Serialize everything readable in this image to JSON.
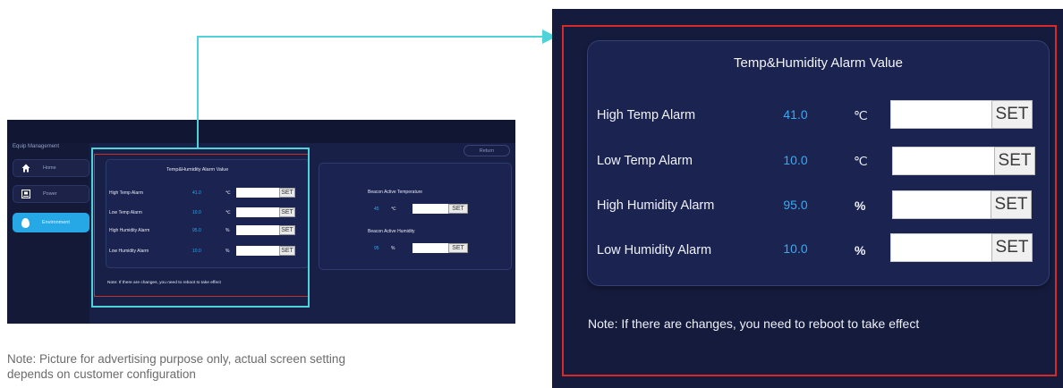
{
  "mini": {
    "sidebar_title": "Equip Management",
    "nav": [
      {
        "label": "Home",
        "icon": "home-icon"
      },
      {
        "label": "Power",
        "icon": "power-panel-icon"
      },
      {
        "label": "Environment",
        "icon": "water-drop-icon"
      }
    ],
    "return_label": "Return",
    "panel_title": "Temp&Humidity Alarm Value",
    "rows": [
      {
        "label": "High Temp Alarm",
        "value": "41.0",
        "unit": "℃",
        "set": "SET"
      },
      {
        "label": "Low Temp Alarm",
        "value": "10.0",
        "unit": "℃",
        "set": "SET"
      },
      {
        "label": "High Humidity Alarm",
        "value": "95.0",
        "unit": "%",
        "set": "SET"
      },
      {
        "label": "Low Humidity Alarm",
        "value": "10.0",
        "unit": "%",
        "set": "SET"
      }
    ],
    "note": "Note: If there are changes, you need to reboot to take effect",
    "beacon": {
      "temp_title": "Beacon Active Temperature",
      "temp_value": "45",
      "temp_unit": "℃",
      "hum_title": "Beacon Active Humidity",
      "hum_value": "95",
      "hum_unit": "%",
      "set": "SET"
    }
  },
  "caption": "Note: Picture for advertising purpose only, actual screen setting depends on customer configuration",
  "big": {
    "title": "Temp&Humidity Alarm Value",
    "rows": [
      {
        "label": "High Temp Alarm",
        "value": "41.0",
        "unit": "℃",
        "set": "SET"
      },
      {
        "label": "Low Temp Alarm",
        "value": "10.0",
        "unit": "℃",
        "set": "SET"
      },
      {
        "label": "High Humidity Alarm",
        "value": "95.0",
        "unit": "%",
        "set": "SET"
      },
      {
        "label": "Low Humidity Alarm",
        "value": "10.0",
        "unit": "%",
        "set": "SET"
      }
    ],
    "note": "Note: If there are changes, you need to reboot to take effect"
  },
  "colors": {
    "highlight_cyan": "#4fd2d8",
    "highlight_red": "#d62a2a",
    "value_blue": "#3aa9f0",
    "active_nav": "#27a8e6",
    "screen_bg": "#151b3d"
  }
}
